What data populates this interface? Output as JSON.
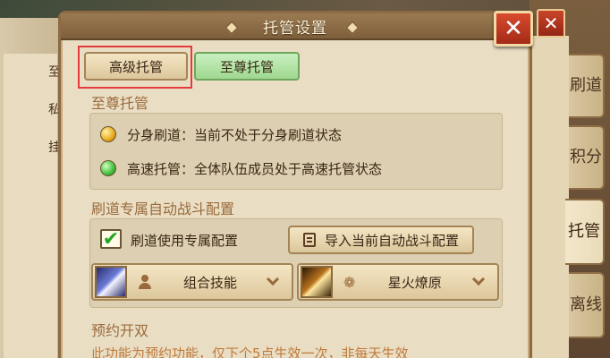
{
  "dialog": {
    "title": "托管设置"
  },
  "tabs": [
    {
      "label": "高级托管"
    },
    {
      "label": "至尊托管"
    }
  ],
  "side_tabs": [
    {
      "label": "刷道"
    },
    {
      "label": "积分"
    },
    {
      "label": "托管"
    },
    {
      "label": "离线"
    }
  ],
  "supreme_section": {
    "title": "至尊托管",
    "rows": [
      {
        "label": "分身刷道：当前不处于分身刷道状态",
        "status_color": "#e7a91c"
      },
      {
        "label": "高速托管：全体队伍成员处于高速托管状态",
        "status_color": "#3fbf3a"
      }
    ]
  },
  "battle_section": {
    "title": "刷道专属自动战斗配置",
    "checkbox_label": "刷道使用专属配置",
    "checkbox_checked": true,
    "import_button": "导入当前自动战斗配置",
    "skill_selects": [
      {
        "label": "组合技能",
        "type_icon": "person-icon"
      },
      {
        "label": "星火燎原",
        "type_icon": "paw-icon"
      }
    ]
  },
  "reserve_section": {
    "title": "预约开双",
    "notice": "此功能为预约功能，仅下个5点生效一次，非每天生效"
  },
  "background": {
    "left_chars": [
      "至",
      "私",
      "挂"
    ]
  }
}
